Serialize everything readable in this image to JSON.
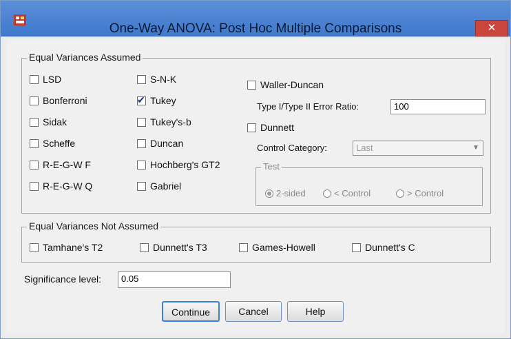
{
  "window": {
    "title": "One-Way ANOVA: Post Hoc Multiple Comparisons",
    "close_label": "✕"
  },
  "equal": {
    "legend": "Equal Variances Assumed",
    "col1": [
      {
        "label": "LSD",
        "checked": false
      },
      {
        "label": "Bonferroni",
        "checked": false
      },
      {
        "label": "Sidak",
        "checked": false
      },
      {
        "label": "Scheffe",
        "checked": false
      },
      {
        "label": "R-E-G-W F",
        "checked": false
      },
      {
        "label": "R-E-G-W Q",
        "checked": false
      }
    ],
    "col2": [
      {
        "label": "S-N-K",
        "checked": false
      },
      {
        "label": "Tukey",
        "checked": true
      },
      {
        "label": "Tukey's-b",
        "checked": false
      },
      {
        "label": "Duncan",
        "checked": false
      },
      {
        "label": "Hochberg's GT2",
        "checked": false
      },
      {
        "label": "Gabriel",
        "checked": false
      }
    ],
    "waller": {
      "label": "Waller-Duncan",
      "checked": false
    },
    "ratio_label": "Type I/Type II Error Ratio:",
    "ratio_value": "100",
    "dunnett": {
      "label": "Dunnett",
      "checked": false
    },
    "control_label": "Control Category:",
    "control_value": "Last",
    "test_legend": "Test",
    "test_options": [
      "2-sided",
      "< Control",
      "> Control"
    ],
    "test_selected": "2-sided"
  },
  "not_equal": {
    "legend": "Equal Variances Not Assumed",
    "items": [
      {
        "label": "Tamhane's T2",
        "checked": false
      },
      {
        "label": "Dunnett's T3",
        "checked": false
      },
      {
        "label": "Games-Howell",
        "checked": false
      },
      {
        "label": "Dunnett's C",
        "checked": false
      }
    ]
  },
  "significance": {
    "label": "Significance level:",
    "value": "0.05"
  },
  "buttons": {
    "continue": "Continue",
    "cancel": "Cancel",
    "help": "Help"
  }
}
